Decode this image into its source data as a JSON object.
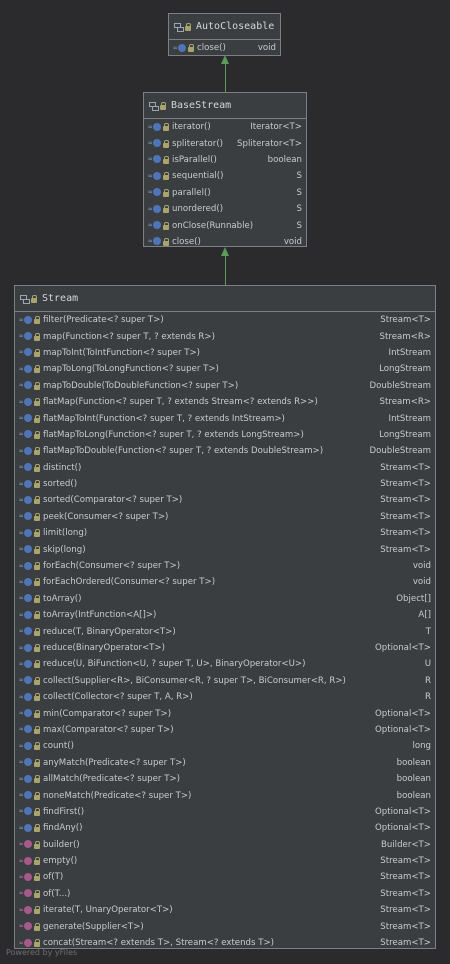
{
  "classes": {
    "autocloseable": {
      "name": "AutoCloseable",
      "methods": [
        {
          "sig": "close()",
          "ret": "void"
        }
      ]
    },
    "basestream": {
      "name": "BaseStream",
      "methods": [
        {
          "sig": "iterator()",
          "ret": "Iterator<T>"
        },
        {
          "sig": "spliterator()",
          "ret": "Spliterator<T>"
        },
        {
          "sig": "isParallel()",
          "ret": "boolean"
        },
        {
          "sig": "sequential()",
          "ret": "S"
        },
        {
          "sig": "parallel()",
          "ret": "S"
        },
        {
          "sig": "unordered()",
          "ret": "S"
        },
        {
          "sig": "onClose(Runnable)",
          "ret": "S"
        },
        {
          "sig": "close()",
          "ret": "void"
        }
      ]
    },
    "stream": {
      "name": "Stream",
      "methods": [
        {
          "sig": "filter(Predicate<? super T>)",
          "ret": "Stream<T>"
        },
        {
          "sig": "map(Function<? super T, ? extends R>)",
          "ret": "Stream<R>"
        },
        {
          "sig": "mapToInt(ToIntFunction<? super T>)",
          "ret": "IntStream"
        },
        {
          "sig": "mapToLong(ToLongFunction<? super T>)",
          "ret": "LongStream"
        },
        {
          "sig": "mapToDouble(ToDoubleFunction<? super T>)",
          "ret": "DoubleStream"
        },
        {
          "sig": "flatMap(Function<? super T, ? extends Stream<? extends R>>)",
          "ret": "Stream<R>"
        },
        {
          "sig": "flatMapToInt(Function<? super T, ? extends IntStream>)",
          "ret": "IntStream"
        },
        {
          "sig": "flatMapToLong(Function<? super T, ? extends LongStream>)",
          "ret": "LongStream"
        },
        {
          "sig": "flatMapToDouble(Function<? super T, ? extends DoubleStream>)",
          "ret": "DoubleStream"
        },
        {
          "sig": "distinct()",
          "ret": "Stream<T>"
        },
        {
          "sig": "sorted()",
          "ret": "Stream<T>"
        },
        {
          "sig": "sorted(Comparator<? super T>)",
          "ret": "Stream<T>"
        },
        {
          "sig": "peek(Consumer<? super T>)",
          "ret": "Stream<T>"
        },
        {
          "sig": "limit(long)",
          "ret": "Stream<T>"
        },
        {
          "sig": "skip(long)",
          "ret": "Stream<T>"
        },
        {
          "sig": "forEach(Consumer<? super T>)",
          "ret": "void"
        },
        {
          "sig": "forEachOrdered(Consumer<? super T>)",
          "ret": "void"
        },
        {
          "sig": "toArray()",
          "ret": "Object[]"
        },
        {
          "sig": "toArray(IntFunction<A[]>)",
          "ret": "A[]"
        },
        {
          "sig": "reduce(T, BinaryOperator<T>)",
          "ret": "T"
        },
        {
          "sig": "reduce(BinaryOperator<T>)",
          "ret": "Optional<T>"
        },
        {
          "sig": "reduce(U, BiFunction<U, ? super T, U>, BinaryOperator<U>)",
          "ret": "U"
        },
        {
          "sig": "collect(Supplier<R>, BiConsumer<R, ? super T>, BiConsumer<R, R>)",
          "ret": "R"
        },
        {
          "sig": "collect(Collector<? super T, A, R>)",
          "ret": "R"
        },
        {
          "sig": "min(Comparator<? super T>)",
          "ret": "Optional<T>"
        },
        {
          "sig": "max(Comparator<? super T>)",
          "ret": "Optional<T>"
        },
        {
          "sig": "count()",
          "ret": "long"
        },
        {
          "sig": "anyMatch(Predicate<? super T>)",
          "ret": "boolean"
        },
        {
          "sig": "allMatch(Predicate<? super T>)",
          "ret": "boolean"
        },
        {
          "sig": "noneMatch(Predicate<? super T>)",
          "ret": "boolean"
        },
        {
          "sig": "findFirst()",
          "ret": "Optional<T>"
        },
        {
          "sig": "findAny()",
          "ret": "Optional<T>"
        },
        {
          "sig": "builder()",
          "ret": "Builder<T>",
          "static": true
        },
        {
          "sig": "empty()",
          "ret": "Stream<T>",
          "static": true
        },
        {
          "sig": "of(T)",
          "ret": "Stream<T>",
          "static": true
        },
        {
          "sig": "of(T...)",
          "ret": "Stream<T>",
          "static": true
        },
        {
          "sig": "iterate(T, UnaryOperator<T>)",
          "ret": "Stream<T>",
          "static": true
        },
        {
          "sig": "generate(Supplier<T>)",
          "ret": "Stream<T>",
          "static": true
        },
        {
          "sig": "concat(Stream<? extends T>, Stream<? extends T>)",
          "ret": "Stream<T>",
          "static": true
        }
      ]
    }
  },
  "footer": "Powered by yFiles",
  "colors": {
    "background": "#2b2b2e",
    "box": "#3b3e40",
    "border": "#7d8082",
    "arrow": "#5e9a5a"
  }
}
